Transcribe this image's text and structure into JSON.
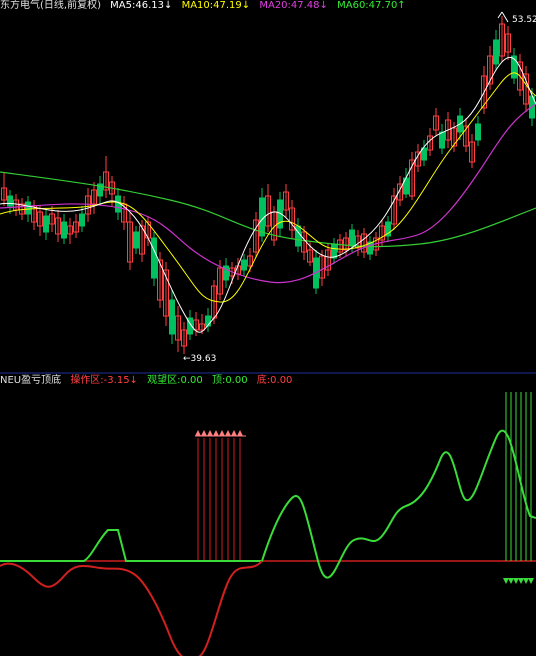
{
  "top_legend": {
    "title": "东方电气(日线,前复权)",
    "ma5": "MA5:46.13↓",
    "ma10": "MA10:47.19↓",
    "ma20": "MA20:47.48↓",
    "ma60": "MA60:47.70↑"
  },
  "bottom_legend": {
    "title": "NEU盈亏顶底",
    "chaodie": "操作区:-3.15↓",
    "guanwang": "观望区:0.00",
    "ding": "顶:0.00",
    "di": "底:0.00"
  },
  "annotations": {
    "high": "53.52",
    "low": "←39.63"
  },
  "colors": {
    "up": "#ff4040",
    "down": "#00c060",
    "ma5": "#ffffff",
    "ma10": "#ffff00",
    "ma20": "#cc33cc",
    "ma60": "#33cc33",
    "green_line": "#3adc3a",
    "red_line": "#d02020",
    "divider": "#2030a0"
  }
}
